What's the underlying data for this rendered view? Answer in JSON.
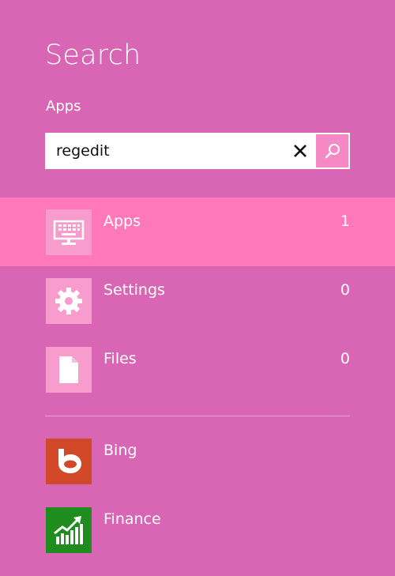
{
  "pane": {
    "title": "Search",
    "scope": "Apps"
  },
  "search": {
    "value": "regedit",
    "placeholder": ""
  },
  "categories": [
    {
      "label": "Apps",
      "count": "1",
      "icon": "keyboard-monitor-icon",
      "selected": true
    },
    {
      "label": "Settings",
      "count": "0",
      "icon": "gear-icon",
      "selected": false
    },
    {
      "label": "Files",
      "count": "0",
      "icon": "document-icon",
      "selected": false
    }
  ],
  "apps": [
    {
      "label": "Bing",
      "icon": "bing-icon",
      "color": "#d2492a"
    },
    {
      "label": "Finance",
      "icon": "finance-chart-icon",
      "color": "#1e8d1e"
    }
  ],
  "colors": {
    "background": "#d966b4",
    "selected_row": "#ff78b9",
    "tile": "#f79ccc",
    "search_button": "#f489c5"
  }
}
